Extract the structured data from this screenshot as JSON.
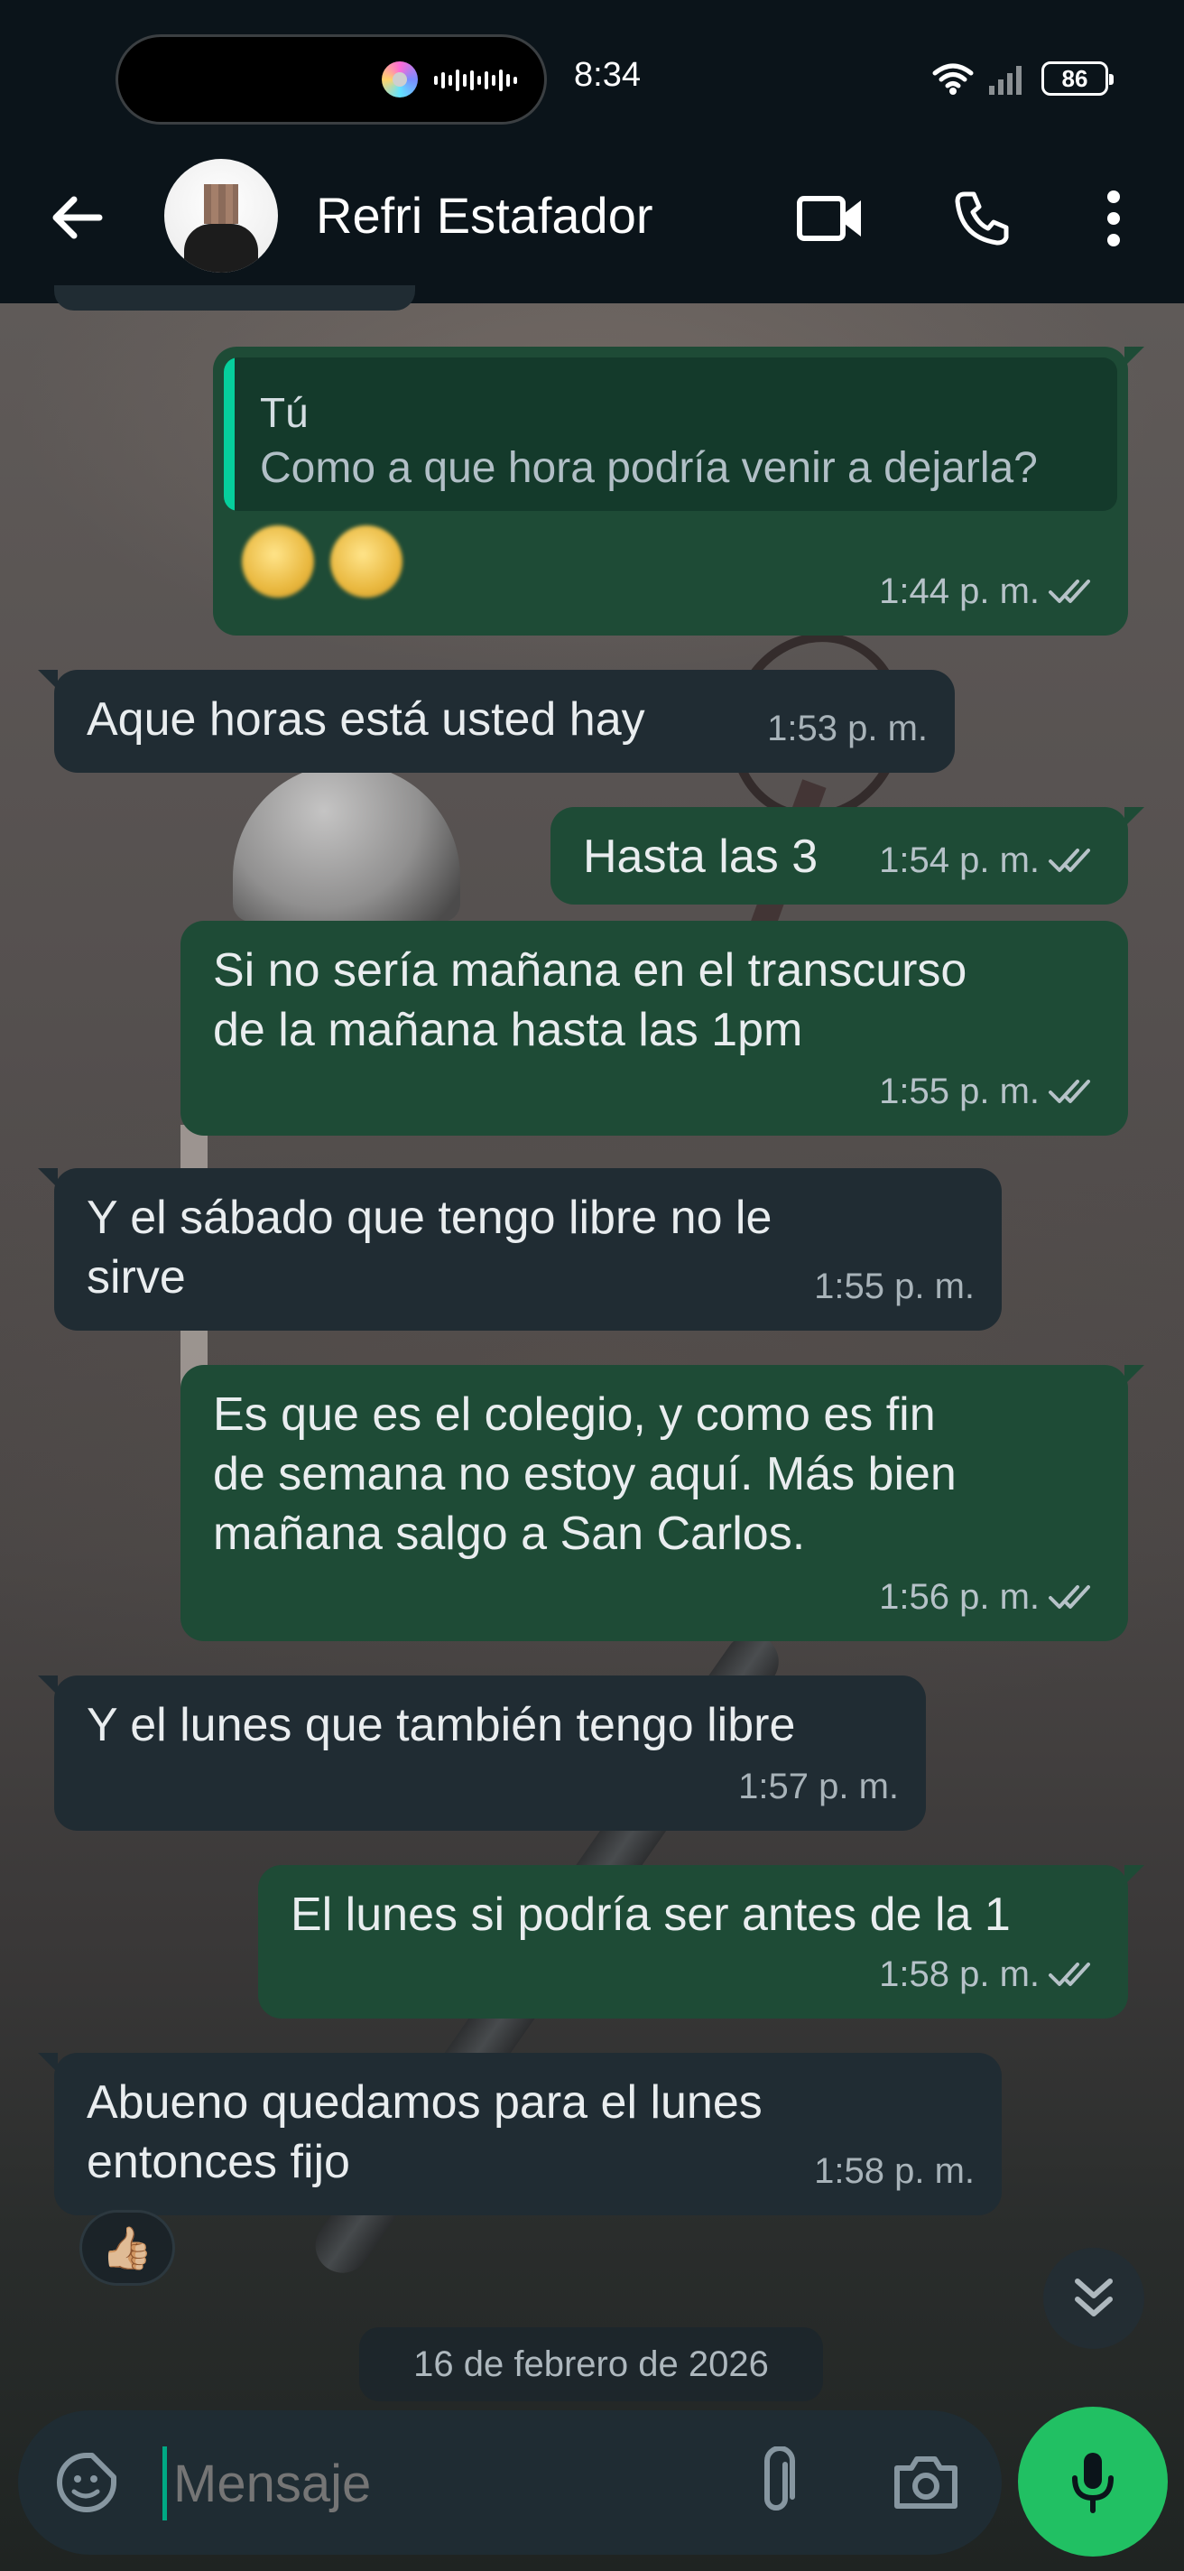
{
  "status_bar": {
    "time": "8:34",
    "battery": "86"
  },
  "header": {
    "contact_name": "Refri Estafador"
  },
  "messages": [
    {
      "direction": "out",
      "quote_author": "Tú",
      "quote_text": "Como a que hora podría venir a dejarla?",
      "time": "1:44 p. m.",
      "read": true
    },
    {
      "direction": "in",
      "text": "Aque horas está usted hay",
      "time": "1:53 p. m."
    },
    {
      "direction": "out",
      "text": "Hasta las 3",
      "time": "1:54 p. m.",
      "read": true
    },
    {
      "direction": "out",
      "lines": [
        "Si no sería mañana en el transcurso",
        "de la mañana hasta las 1pm"
      ],
      "time": "1:55 p. m.",
      "read": true
    },
    {
      "direction": "in",
      "lines": [
        "Y el sábado que tengo libre no le",
        "sirve"
      ],
      "time": "1:55 p. m."
    },
    {
      "direction": "out",
      "lines": [
        "Es que es el colegio, y como es fin",
        "de semana no estoy aquí. Más bien",
        "mañana salgo a San Carlos."
      ],
      "time": "1:56 p. m.",
      "read": true
    },
    {
      "direction": "in",
      "text": "Y el lunes que también tengo libre",
      "time": "1:57 p. m."
    },
    {
      "direction": "out",
      "text": "El lunes si podría ser antes de la 1",
      "time": "1:58 p. m.",
      "read": true
    },
    {
      "direction": "in",
      "lines": [
        "Abueno quedamos para el lunes",
        "entonces fijo"
      ],
      "time": "1:58 p. m.",
      "reaction": "👍🏼"
    }
  ],
  "date_separator": "16 de febrero de 2026",
  "composer": {
    "placeholder": "Mensaje"
  },
  "colors": {
    "outgoing_bubble": "#1e4b36",
    "incoming_bubble": "#202c33",
    "accent": "#21c063"
  },
  "icons": {
    "back": "arrow-left-icon",
    "video": "video-camera-icon",
    "call": "phone-icon",
    "menu": "more-vertical-icon",
    "sticker": "sticker-icon",
    "attach": "paperclip-icon",
    "camera": "camera-icon",
    "mic": "microphone-icon",
    "scroll": "chevrons-down-icon"
  }
}
